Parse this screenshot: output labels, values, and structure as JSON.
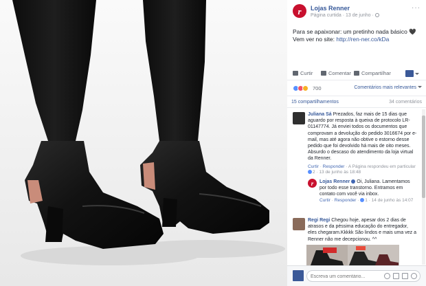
{
  "post": {
    "page_name": "Lojas Renner",
    "page_logo_letter": "r",
    "meta": "Página curtida · 13 de junho ·",
    "more": "···",
    "text_line1": "Para se apaixonar: um pretinho nada básico 🖤",
    "text_line2_prefix": "Vem ver no site: ",
    "link": "http://ren-ner.co/kDa"
  },
  "actions": {
    "like": "Curtir",
    "comment": "Comentar",
    "share": "Compartilhar"
  },
  "reactions": {
    "count": "700",
    "sort_label": "Comentários mais relevantes"
  },
  "counts": {
    "shares": "15 compartilhamentos",
    "comments": "34 comentários"
  },
  "comments": [
    {
      "author": "Juliana Sá",
      "text": " Prezados, faz mais de 15 dias que aguardo por resposta à queixa de protocolo LR-01147774. Já enviei todos os documentos que comprovam a devolução do pedido 3016674 por e-mail, mas até agora não obtive o estorno desse pedido que foi devolvido há mais de oito meses. Absurdo o descaso do atendimento da loja virtual da Renner.",
      "footer_like": "Curtir",
      "footer_reply": "Responder",
      "footer_rest": " · A Página respondeu em particular",
      "likes": "2",
      "time": "· 13 de junho às 18:48"
    },
    {
      "author": "Lojas Renner",
      "text": " Oi, Juliana. Lamentamos por todo esse transtorno. Entramos em contato com você via inbox.",
      "footer_like": "Curtir",
      "footer_reply": "Responder",
      "likes": "1",
      "time": "· 14 de junho às 14:07"
    },
    {
      "author": "Regi Regi",
      "text": " Chegou hoje, apesar dos 2 dias de atrasos e da péssima educação do entregador, eles chegaram.Kkkkk São lindos e mais uma vez a Renner não me decepcionou. ^^"
    }
  ],
  "composer": {
    "placeholder": "Escreva um comentário..."
  },
  "colors": {
    "brand_red": "#c8102e",
    "facebook_blue": "#365899"
  }
}
